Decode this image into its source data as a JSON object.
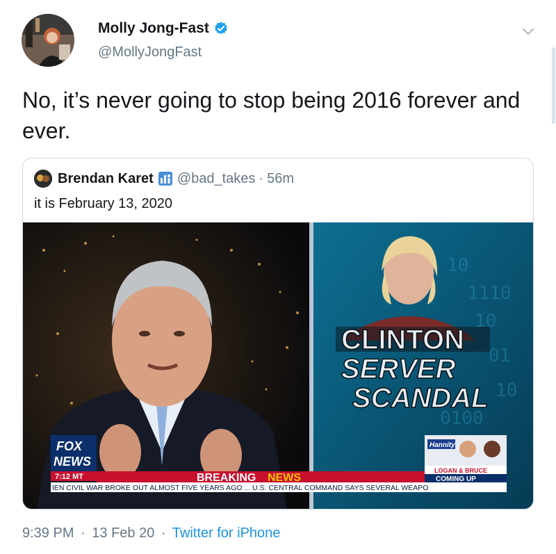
{
  "author": {
    "name": "Molly Jong-Fast",
    "handle": "@MollyJongFast",
    "avatar_icon": "profile-photo",
    "verified": true
  },
  "tweet": {
    "text": "No, it’s never going to stop being 2016 forever and ever."
  },
  "quoted": {
    "name": "Brendan Karet",
    "handle": "@bad_takes",
    "time": "56m",
    "dot": "·",
    "text": "it is February 13, 2020",
    "badge_icon": "staff-badge-icon",
    "media": {
      "network_logo_1": "FOX",
      "network_logo_2": "NEWS",
      "clock": "7:12 MT",
      "breaking": "BREAKING",
      "news": "NEWS",
      "headline_1": "CLINTON",
      "headline_2": "SERVER",
      "headline_3": "SCANDAL",
      "show_tag": "Hannity",
      "promo_1": "LOGAN & BRUCE",
      "promo_2": "COMING UP",
      "ticker": "IEN CIVIL WAR BROKE OUT ALMOST FIVE YEARS AGO ... U.S. CENTRAL COMMAND SAYS SEVERAL WEAPO"
    }
  },
  "footer": {
    "time": "9:39 PM",
    "sep": "·",
    "date": "13 Feb 20",
    "source": "Twitter for iPhone"
  },
  "colors": {
    "link": "#1b95e0",
    "muted": "#657786",
    "verified": "#1da1f2",
    "breaking_red": "#d0101a"
  }
}
